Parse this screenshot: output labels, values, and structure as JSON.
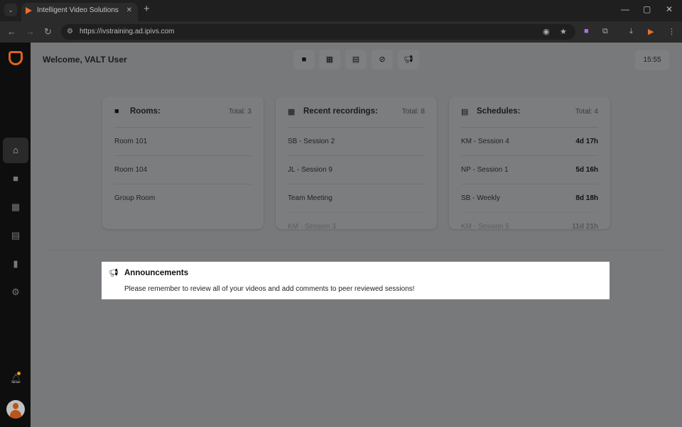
{
  "browser": {
    "tab_title": "Intelligent Video Solutions",
    "url": "https://ivstraining.ad.ipivs.com"
  },
  "header": {
    "welcome": "Welcome, VALT User",
    "clock": "15:55",
    "quick_actions": [
      {
        "icon": "video-camera-icon"
      },
      {
        "icon": "film-icon"
      },
      {
        "icon": "schedule-icon"
      },
      {
        "icon": "no-signal-icon"
      },
      {
        "icon": "megaphone-icon"
      }
    ]
  },
  "sidebar": {
    "items": [
      {
        "icon": "home-icon",
        "active": true
      },
      {
        "icon": "video-camera-icon"
      },
      {
        "icon": "film-icon"
      },
      {
        "icon": "schedule-icon"
      },
      {
        "icon": "chart-icon"
      },
      {
        "icon": "gear-icon"
      }
    ],
    "notification_dot_color": "#e89a1c"
  },
  "cards": {
    "rooms": {
      "title": "Rooms:",
      "total": "Total: 3",
      "rows": [
        {
          "name": "Room 101"
        },
        {
          "name": "Room 104"
        },
        {
          "name": "Group Room"
        }
      ]
    },
    "recordings": {
      "title": "Recent recordings:",
      "total": "Total: 8",
      "rows": [
        {
          "name": "SB - Session 2"
        },
        {
          "name": "JL - Session 9"
        },
        {
          "name": "Team Meeting"
        },
        {
          "name": "KM - Session 3"
        }
      ]
    },
    "schedules": {
      "title": "Schedules:",
      "total": "Total: 4",
      "rows": [
        {
          "name": "KM - Session 4",
          "time": "4d 17h"
        },
        {
          "name": "NP - Session 1",
          "time": "5d 16h"
        },
        {
          "name": "SB - Weekly",
          "time": "8d 18h"
        },
        {
          "name": "KM - Session 5",
          "time": "11d 21h"
        }
      ]
    }
  },
  "announcements": {
    "title": "Announcements",
    "message": "Please remember to review all of your videos and add comments to peer reviewed sessions!"
  },
  "colors": {
    "brand": "#d9661f"
  }
}
